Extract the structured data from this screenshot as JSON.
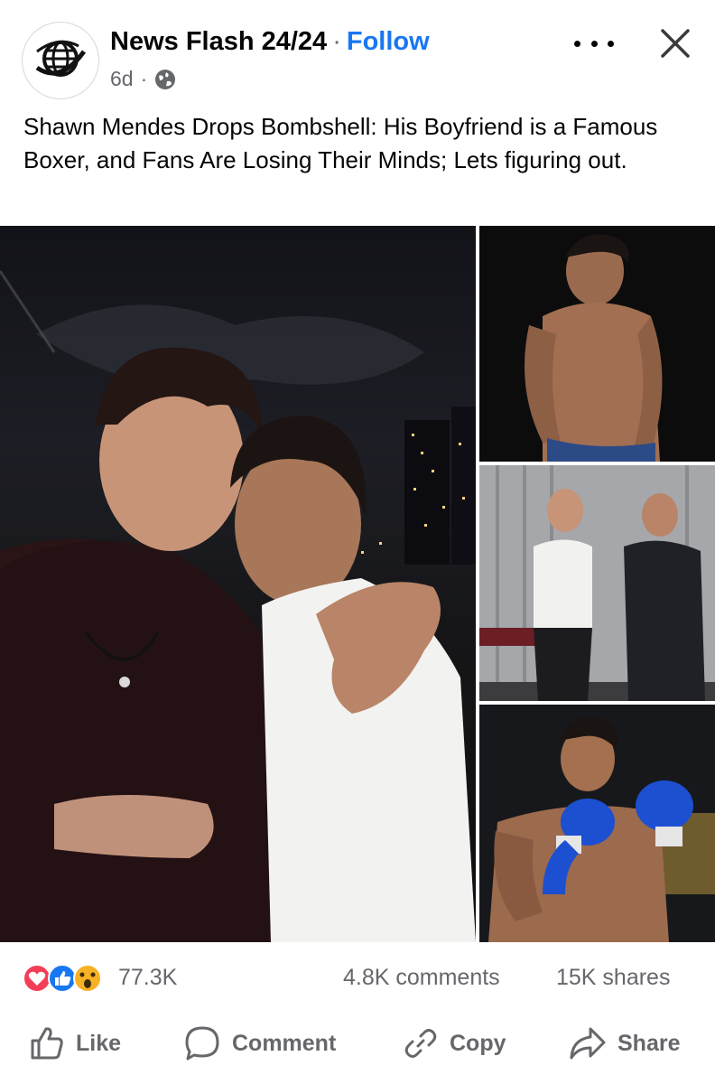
{
  "post": {
    "page_name": "News Flash 24/24",
    "separator": "·",
    "follow_label": "Follow",
    "time": "6d",
    "caption": "Shawn Mendes Drops Bombshell: His Boyfriend is a Famous Boxer, and Fans Are Losing Their Minds; Lets figuring out."
  },
  "photos": [
    {
      "icon": "photo-two-men-night-city"
    },
    {
      "icon": "photo-shirtless-boxer"
    },
    {
      "icon": "photo-two-men-studio"
    },
    {
      "icon": "photo-boxer-blue-gloves"
    }
  ],
  "stats": {
    "reactions_count": "77.3K",
    "comments": "4.8K comments",
    "shares": "15K shares",
    "reactions": [
      "love",
      "like",
      "wow"
    ]
  },
  "actions": {
    "like": "Like",
    "comment": "Comment",
    "copy": "Copy",
    "share": "Share"
  },
  "colors": {
    "accent": "#1877f2",
    "secondary_text": "#65676b",
    "love": "#f33e58",
    "like": "#1877f2",
    "wow": "#f7b125"
  }
}
